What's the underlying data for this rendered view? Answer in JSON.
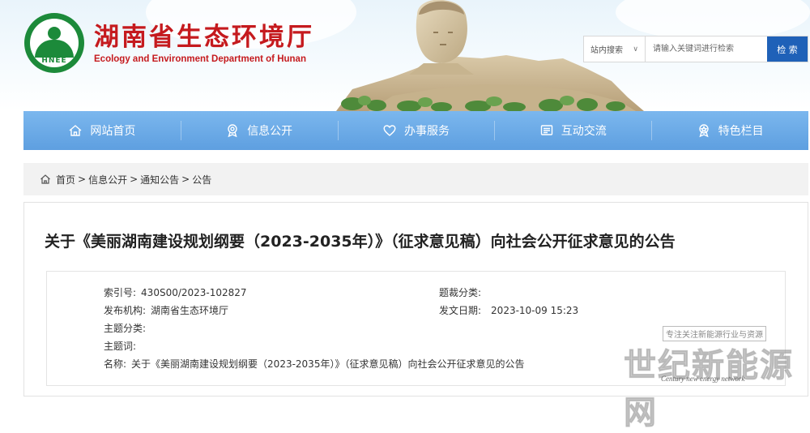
{
  "header": {
    "title_cn": "湖南省生态环境厅",
    "title_en": "Ecology and Environment Department of Hunan",
    "logo_text": "HNEE",
    "brand_color": "#c51a1e",
    "logo_color": "#1c8a3a"
  },
  "search": {
    "scope_label": "站内搜索",
    "placeholder": "请输入关键词进行检索",
    "button_label": "检 索",
    "button_color": "#1f61b8"
  },
  "nav": {
    "items": [
      {
        "label": "网站首页",
        "icon": "home-icon"
      },
      {
        "label": "信息公开",
        "icon": "medal-icon"
      },
      {
        "label": "办事服务",
        "icon": "heart-icon"
      },
      {
        "label": "互动交流",
        "icon": "chat-icon"
      },
      {
        "label": "特色栏目",
        "icon": "badge-icon"
      }
    ]
  },
  "breadcrumb": {
    "items": [
      "首页",
      "信息公开",
      "通知公告",
      "公告"
    ],
    "separator": ">"
  },
  "article": {
    "title": "关于《美丽湖南建设规划纲要（2023-2035年）》（征求意见稿）向社会公开征求意见的公告",
    "meta": {
      "index_label": "索引号:",
      "index_value": "430S00/2023-102827",
      "category_label": "题裁分类:",
      "category_value": "",
      "publisher_label": "发布机构:",
      "publisher_value": "湖南省生态环境厅",
      "date_label": "发文日期:",
      "date_value": "2023-10-09 15:23",
      "topic_label": "主题分类:",
      "topic_value": "",
      "keywords_label": "主题词:",
      "keywords_value": "",
      "name_label": "名称:",
      "name_value": "关于《美丽湖南建设规划纲要（2023-2035年）》（征求意见稿）向社会公开征求意见的公告"
    }
  },
  "watermark": {
    "slogan": "专注关注新能源行业与资源",
    "name_cn": "世纪新能源网",
    "name_en": "Century new energy network"
  }
}
